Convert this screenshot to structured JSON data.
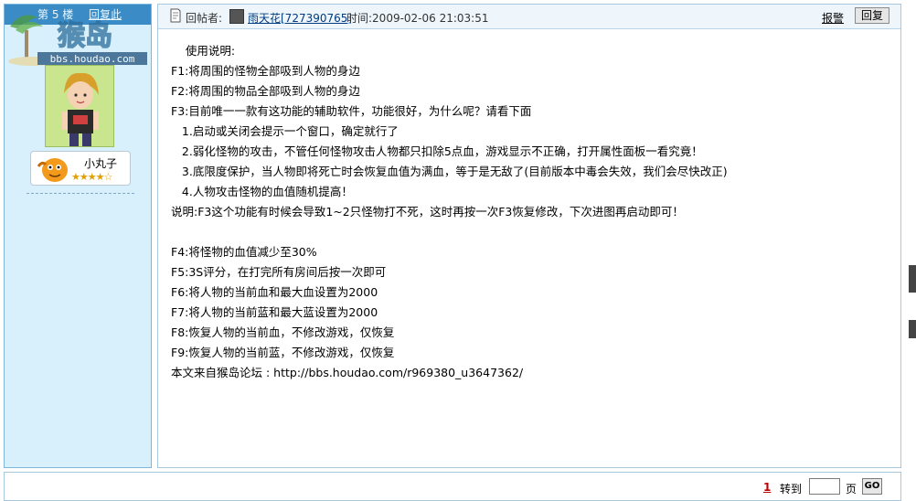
{
  "left_panel": {
    "floor": "第 5 楼",
    "mark_label": "回复此",
    "watermark_title": "猴岛",
    "watermark_url": "bbs.houdao.com",
    "username": "小丸子",
    "stars": "★★★★☆"
  },
  "post": {
    "reply_label": "回帖者:",
    "poster": "雨天花[727390765]",
    "time_label": "时间:2009-02-06 21:03:51",
    "report_label": "报警",
    "reply_button": "回复",
    "body": "    使用说明:\nF1:将周围的怪物全部吸到人物的身边\nF2:将周围的物品全部吸到人物的身边\nF3:目前唯一一款有这功能的辅助软件，功能很好，为什么呢？请看下面\n   1.启动或关闭会提示一个窗口，确定就行了\n   2.弱化怪物的攻击，不管任何怪物攻击人物都只扣除5点血，游戏显示不正确，打开属性面板一看究竟！\n   3.底限度保护，当人物即将死亡时会恢复血值为满血，等于是无敌了(目前版本中毒会失效，我们会尽快改正)\n   4.人物攻击怪物的血值随机提高！\n说明:F3这个功能有时候会导致1~2只怪物打不死，这时再按一次F3恢复修改，下次进图再启动即可！\n\nF4:将怪物的血值减少至30%\nF5:3S评分，在打完所有房间后按一次即可\nF6:将人物的当前血和最大血设置为2000\nF7:将人物的当前蓝和最大蓝设置为2000\nF8:恢复人物的当前血，不修改游戏，仅恢复\nF9:恢复人物的当前蓝，不修改游戏，仅恢复\n本文来自猴岛论坛 : http://bbs.houdao.com/r969380_u3647362/"
  },
  "pager": {
    "current_page": "1",
    "goto_label": "转到",
    "page_input_value": "",
    "page_unit": "页",
    "go_button": "GO"
  }
}
